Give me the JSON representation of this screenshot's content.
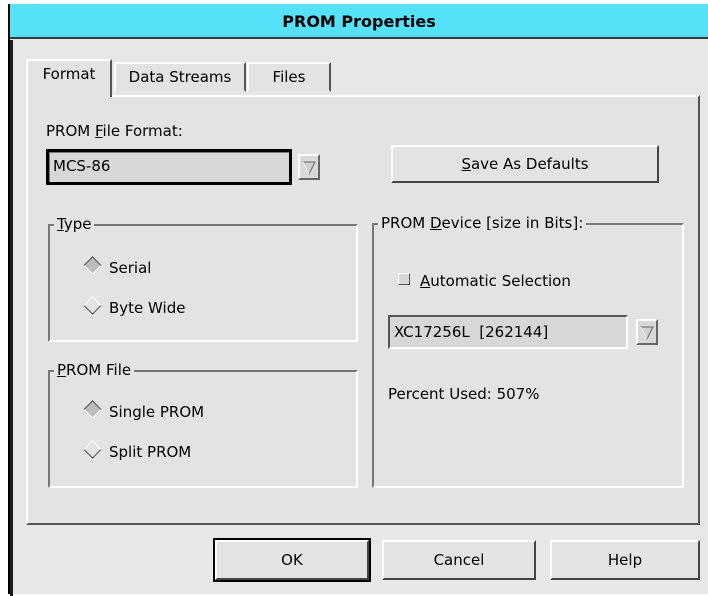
{
  "window": {
    "title": "PROM Properties"
  },
  "tabs": [
    {
      "label": "Format",
      "active": true
    },
    {
      "label": "Data Streams",
      "active": false
    },
    {
      "label": "Files",
      "active": false
    }
  ],
  "format": {
    "file_format_label_pre": "PROM ",
    "file_format_label_key": "F",
    "file_format_label_post": "ile Format:",
    "file_format_value": "MCS-86",
    "save_defaults_key": "S",
    "save_defaults_rest": "ave As Defaults"
  },
  "type_group": {
    "legend_key": "T",
    "legend_rest": "ype",
    "options": [
      {
        "label": "Serial",
        "selected": true
      },
      {
        "label": "Byte Wide",
        "selected": false
      }
    ]
  },
  "prom_file_group": {
    "legend_key": "P",
    "legend_rest": "ROM File",
    "options": [
      {
        "label": "Single PROM",
        "selected": true
      },
      {
        "label": "Split PROM",
        "selected": false
      }
    ]
  },
  "device_group": {
    "legend_pre": "PROM ",
    "legend_key": "D",
    "legend_post": "evice [size in Bits]:",
    "auto_key": "A",
    "auto_rest": "utomatic Selection",
    "auto_checked": false,
    "device_value": "XC17256L  [262144]",
    "percent_used": "Percent Used: 507%"
  },
  "buttons": {
    "ok": "OK",
    "cancel": "Cancel",
    "help": "Help"
  },
  "icons": {
    "dropdown": "chevron-down-icon",
    "radio": "diamond-radio-icon",
    "checkbox": "square-check-icon"
  },
  "colors": {
    "titlebar": "#55e1f7",
    "background": "#e3e3e3"
  }
}
